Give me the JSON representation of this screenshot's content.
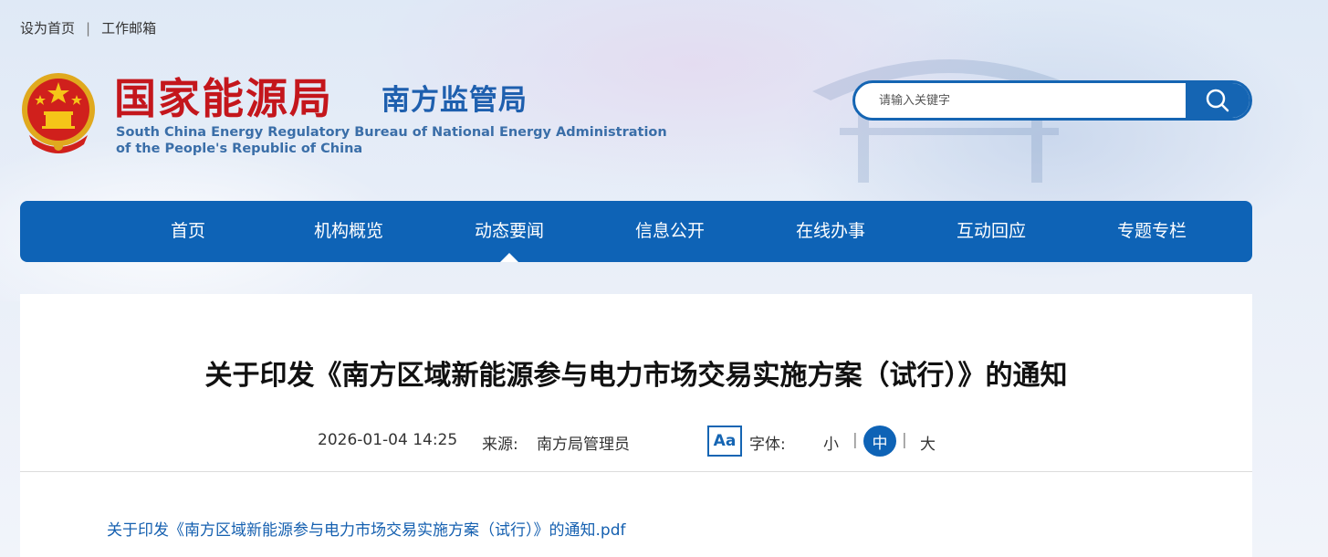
{
  "toplinks": {
    "set_homepage": "设为首页",
    "separator": "|",
    "work_email": "工作邮箱"
  },
  "brand": {
    "title_cn": "国家能源局",
    "subtitle_cn": "南方监管局",
    "title_en_line1": "South China Energy Regulatory Bureau of National Energy Administration",
    "title_en_line2": "of the People's Republic of China",
    "emblem_icon": "national-emblem-icon"
  },
  "search": {
    "placeholder": "请输入关键字",
    "button_icon": "search-icon"
  },
  "nav": {
    "items": [
      {
        "label": "首页"
      },
      {
        "label": "机构概览"
      },
      {
        "label": "动态要闻"
      },
      {
        "label": "信息公开"
      },
      {
        "label": "在线办事"
      },
      {
        "label": "互动回应"
      },
      {
        "label": "专题专栏"
      }
    ],
    "active": "动态要闻"
  },
  "article": {
    "title": "关于印发《南方区域新能源参与电力市场交易实施方案（试行）》的通知",
    "date": "2026-01-04 14:25",
    "source_label": "来源:",
    "source_value": "南方局管理员",
    "font_icon_text": "Aa",
    "font_label": "字体:",
    "font_small": "小",
    "font_medium": "中",
    "font_large": "大",
    "font_sep": "|",
    "attachment": "关于印发《南方区域新能源参与电力市场交易实施方案（试行）》的通知.pdf"
  },
  "colors": {
    "brand_red": "#c4161c",
    "brand_blue": "#1565b3",
    "nav_blue": "#0e63b6",
    "link_blue": "#1560b0"
  }
}
